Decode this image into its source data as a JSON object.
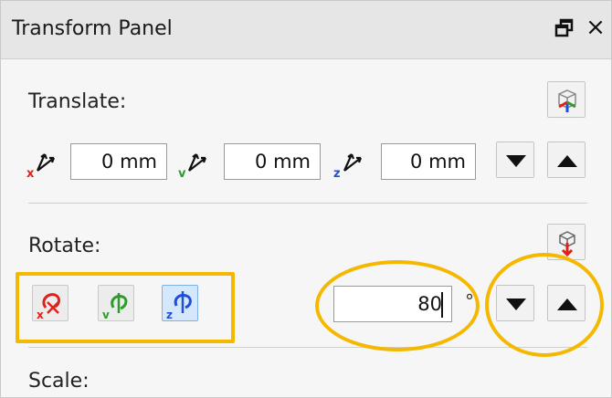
{
  "panel": {
    "title": "Transform Panel",
    "float_icon": "float-window-icon",
    "close_label": "×"
  },
  "translate": {
    "label": "Translate:",
    "x_value": "0 mm",
    "y_value": "0 mm",
    "z_value": "0 mm",
    "icons": [
      "x-axis-icon",
      "y-axis-icon",
      "z-axis-icon"
    ]
  },
  "rotate": {
    "label": "Rotate:",
    "value": "80",
    "unit": "°",
    "selected_axis": "z",
    "axis_buttons": [
      "rotate-x-button",
      "rotate-y-button",
      "rotate-z-button"
    ]
  },
  "scale": {
    "label": "Scale:"
  },
  "colors": {
    "x_axis": "#e0211b",
    "y_axis": "#2e9b2c",
    "z_axis": "#1f4fd8",
    "highlight": "#f5b800",
    "active_button_bg": "#d5e8fb"
  }
}
